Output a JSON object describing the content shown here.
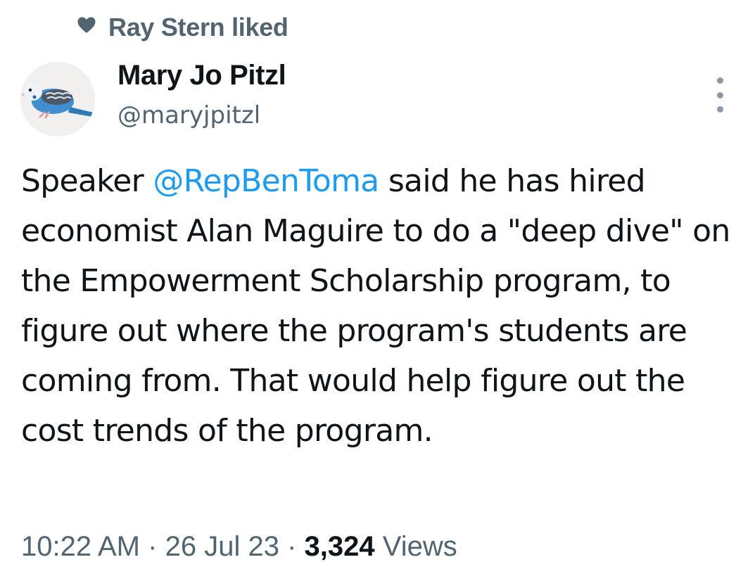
{
  "social_context": {
    "icon": "heart-icon",
    "text": "Ray Stern liked"
  },
  "author": {
    "avatar": "parakeet-avatar",
    "name": "Mary Jo Pitzl",
    "handle": "@maryjpitzl"
  },
  "tweet": {
    "text_before_mention": "Speaker ",
    "mention": "@RepBenToma",
    "text_after_mention": " said he has hired economist Alan Maguire to do a \"deep dive\" on the Empowerment Scholarship program, to figure out where the program's students are coming from. That would help figure out the cost trends of the program.",
    "mention_color": "#1d9bf0"
  },
  "meta": {
    "time": "10:22 AM",
    "separator": "·",
    "date": "26 Jul 23",
    "views_count": "3,324",
    "views_label": "Views"
  },
  "more_menu": {
    "icon": "more-vertical-icon"
  }
}
